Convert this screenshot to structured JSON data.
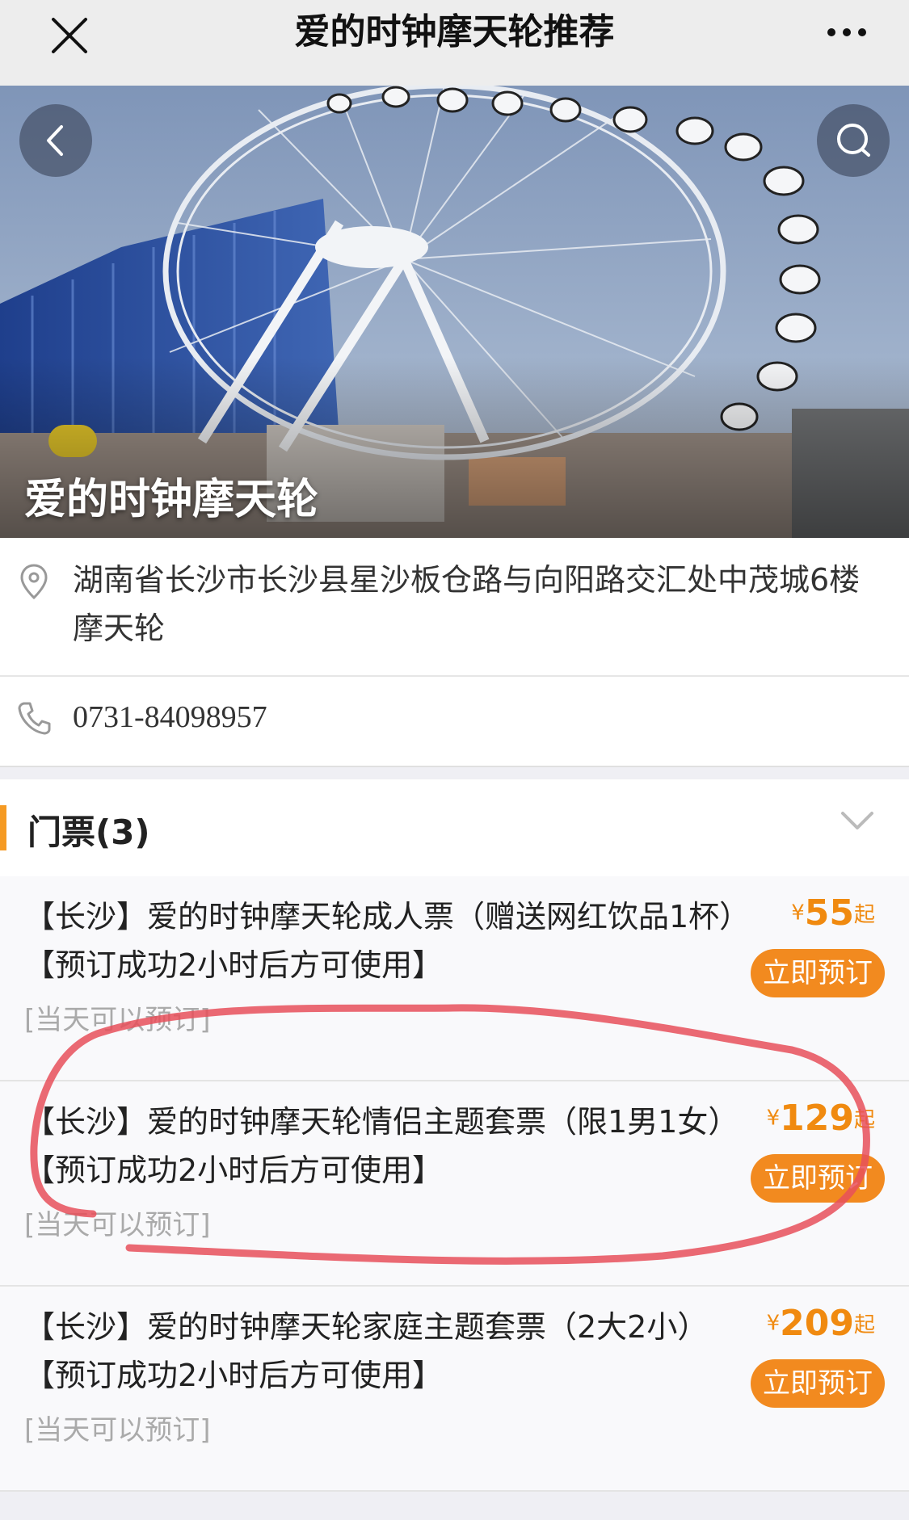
{
  "navbar": {
    "title": "爱的时钟摩天轮推荐",
    "close_icon": "close-icon",
    "more_icon": "more-icon"
  },
  "hero": {
    "title": "爱的时钟摩天轮",
    "back_icon": "back-icon",
    "search_icon": "search-icon"
  },
  "info": {
    "address": "湖南省长沙市长沙县星沙板仓路与向阳路交汇处中茂城6楼摩天轮",
    "phone": "0731-84098957",
    "address_icon": "location-pin-icon",
    "phone_icon": "phone-icon"
  },
  "tickets": {
    "title": "门票(3)",
    "expand_icon": "chevron-down-icon",
    "items": [
      {
        "name": "【长沙】爱的时钟摩天轮成人票（赠送网红饮品1杯）【预订成功2小时后方可使用】",
        "note": "[当天可以预订]",
        "currency": "¥",
        "price": "55",
        "suffix": "起",
        "button": "立即预订"
      },
      {
        "name": "【长沙】爱的时钟摩天轮情侣主题套票（限1男1女）【预订成功2小时后方可使用】",
        "note": "[当天可以预订]",
        "currency": "¥",
        "price": "129",
        "suffix": "起",
        "button": "立即预订"
      },
      {
        "name": "【长沙】爱的时钟摩天轮家庭主题套票（2大2小）【预订成功2小时后方可使用】",
        "note": "[当天可以预订]",
        "currency": "¥",
        "price": "209",
        "suffix": "起",
        "button": "立即预订"
      }
    ]
  },
  "colors": {
    "accent": "#f08a10",
    "button": "#f28a1f",
    "annotation": "#e8505b"
  }
}
